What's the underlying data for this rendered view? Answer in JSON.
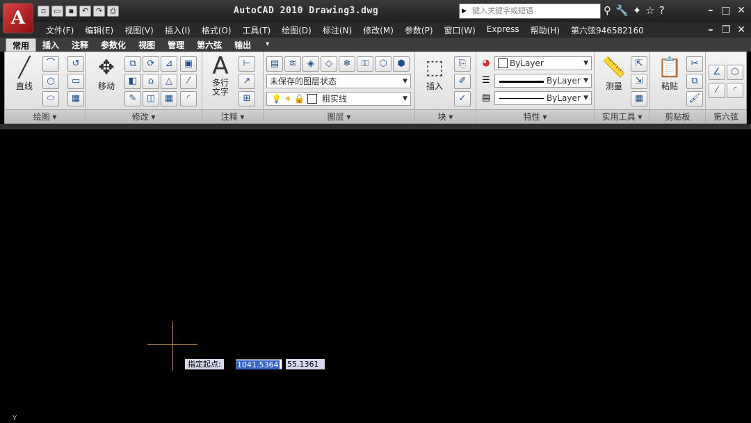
{
  "app": {
    "title": "AutoCAD 2010   Drawing3.dwg",
    "logo": "A"
  },
  "search": {
    "placeholder": "键入关键字或短语"
  },
  "menu": {
    "items": [
      "文件(F)",
      "编辑(E)",
      "视图(V)",
      "插入(I)",
      "格式(O)",
      "工具(T)",
      "绘图(D)",
      "标注(N)",
      "修改(M)",
      "参数(P)",
      "窗口(W)",
      "Express",
      "帮助(H)",
      "第六弦946582160"
    ]
  },
  "tabs": [
    "常用",
    "插入",
    "注释",
    "参数化",
    "视图",
    "管理",
    "第六弦",
    "输出"
  ],
  "panels": {
    "draw": {
      "title": "绘图 ▾",
      "line_label": "直线"
    },
    "modify": {
      "title": "修改 ▾",
      "move_label": "移动"
    },
    "annotate": {
      "title": "注释 ▾",
      "text_label": "多行\n文字"
    },
    "layers": {
      "title": "图层 ▾",
      "state": "未保存的图层状态",
      "current": "粗实线"
    },
    "block": {
      "title": "块 ▾",
      "insert_label": "插入"
    },
    "properties": {
      "title": "特性 ▾",
      "color": "ByLayer",
      "lineweight": "ByLayer",
      "linetype": "ByLayer"
    },
    "utilities": {
      "title": "实用工具 ▾",
      "measure_label": "测量"
    },
    "clipboard": {
      "title": "剪贴板",
      "paste_label": "粘贴"
    },
    "custom": {
      "title": "第六弦"
    }
  },
  "canvas": {
    "prompt": "指定起点:",
    "x_value": "1041.5364",
    "y_value": "55.1361",
    "crosshair_color": "#b88d5a"
  }
}
